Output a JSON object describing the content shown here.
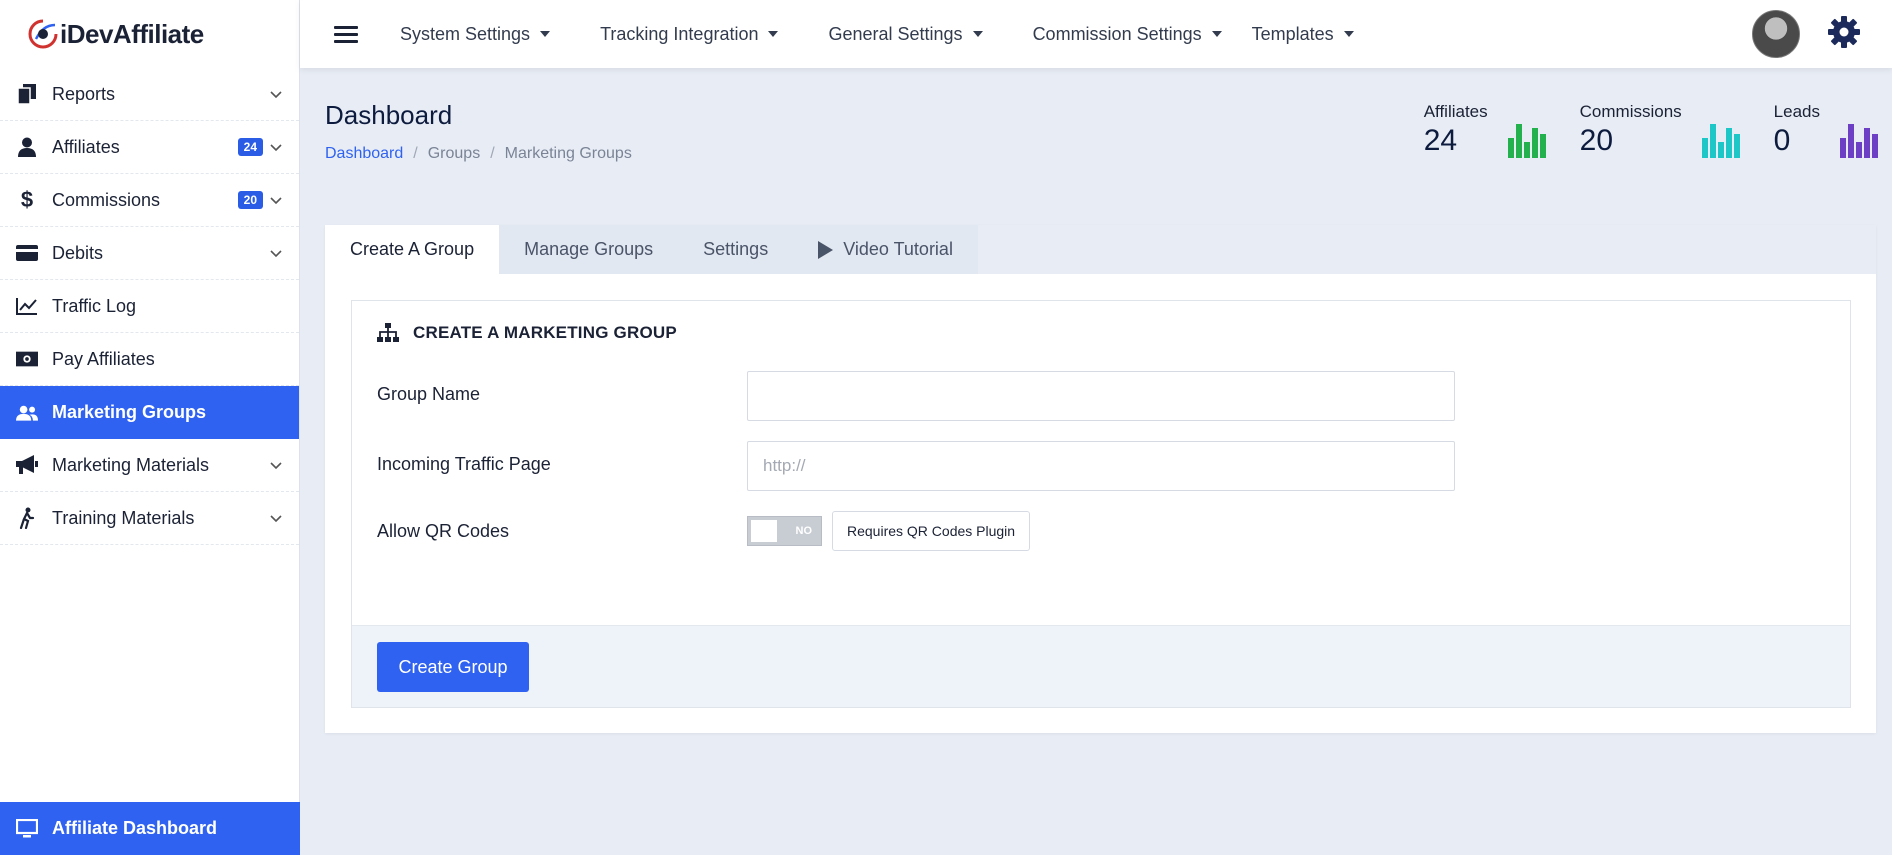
{
  "brand": {
    "name": "iDevAffiliate"
  },
  "sidebar": {
    "items": [
      {
        "label": "Reports",
        "icon": "reports-icon"
      },
      {
        "label": "Affiliates",
        "badge": "24",
        "icon": "user-icon"
      },
      {
        "label": "Commissions",
        "badge": "20",
        "icon": "dollar-icon"
      },
      {
        "label": "Debits",
        "icon": "card-icon"
      },
      {
        "label": "Traffic Log",
        "icon": "chart-line-icon"
      },
      {
        "label": "Pay Affiliates",
        "icon": "money-icon"
      },
      {
        "label": "Marketing Groups",
        "icon": "users-icon",
        "active": true
      },
      {
        "label": "Marketing Materials",
        "icon": "megaphone-icon"
      },
      {
        "label": "Training Materials",
        "icon": "walking-icon"
      }
    ],
    "footer_label": "Affiliate Dashboard"
  },
  "topbar": {
    "menu": [
      "System Settings",
      "Tracking Integration",
      "General Settings",
      "Commission Settings",
      "Templates"
    ]
  },
  "header": {
    "title": "Dashboard",
    "breadcrumb": [
      "Dashboard",
      "Groups",
      "Marketing Groups"
    ]
  },
  "stats": [
    {
      "label": "Affiliates",
      "value": "24",
      "color": "#22b14c"
    },
    {
      "label": "Commissions",
      "value": "20",
      "color": "#1ec7c7"
    },
    {
      "label": "Leads",
      "value": "0",
      "color": "#6c3fc4"
    }
  ],
  "tabs": [
    "Create A Group",
    "Manage Groups",
    "Settings",
    "Video Tutorial"
  ],
  "form": {
    "title": "CREATE A MARKETING GROUP",
    "group_name_label": "Group Name",
    "group_name_value": "",
    "traffic_label": "Incoming Traffic Page",
    "traffic_placeholder": "http://",
    "qr_label": "Allow QR Codes",
    "qr_state": "NO",
    "qr_note": "Requires QR Codes Plugin",
    "submit_label": "Create Group"
  },
  "colors": {
    "accent": "#2f62f0",
    "sidebar_active": "#2f62f0"
  }
}
